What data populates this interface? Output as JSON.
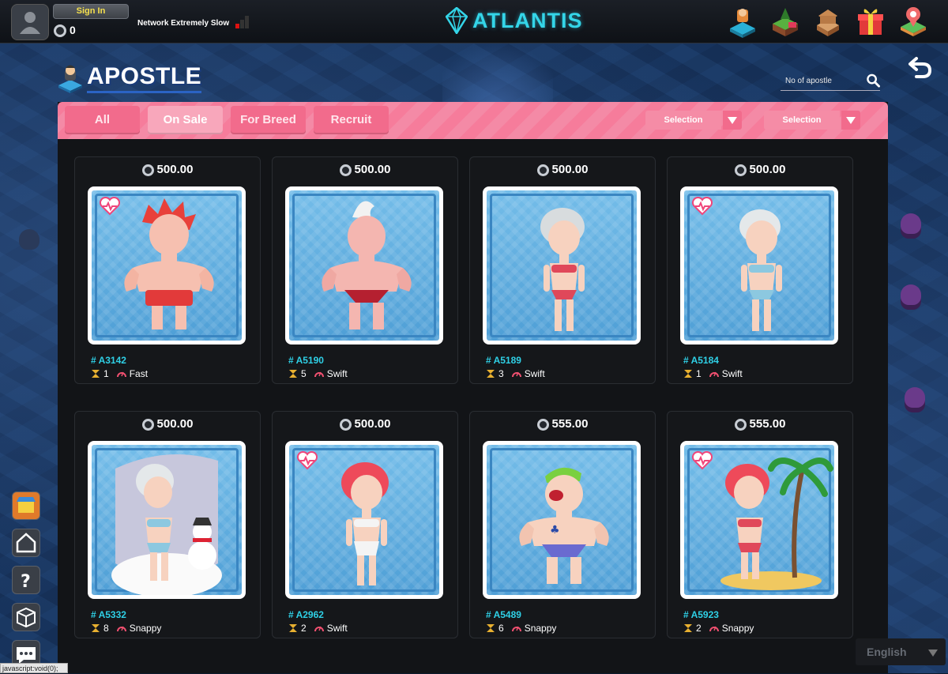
{
  "header": {
    "sign_in_label": "Sign In",
    "balance": "0",
    "network_status": "Network Extremely Slow",
    "logo_text": "ATLANTIS",
    "icons": [
      "apostle-icon",
      "land-icon",
      "museum-icon",
      "gift-icon",
      "map-pin-icon"
    ]
  },
  "page": {
    "title": "APOSTLE",
    "search_placeholder": "No of apostle"
  },
  "filters": {
    "tabs": [
      {
        "label": "All",
        "active": false
      },
      {
        "label": "On Sale",
        "active": true
      },
      {
        "label": "For Breed",
        "active": false
      },
      {
        "label": "Recruit",
        "active": false
      }
    ],
    "selects": [
      {
        "label": "Selection"
      },
      {
        "label": "Selection"
      }
    ]
  },
  "cards": [
    {
      "price": "500.00",
      "id": "# A3142",
      "gen": "1",
      "speed": "Fast",
      "heart": true
    },
    {
      "price": "500.00",
      "id": "# A5190",
      "gen": "5",
      "speed": "Swift",
      "heart": false
    },
    {
      "price": "500.00",
      "id": "# A5189",
      "gen": "3",
      "speed": "Swift",
      "heart": false
    },
    {
      "price": "500.00",
      "id": "# A5184",
      "gen": "1",
      "speed": "Swift",
      "heart": true
    },
    {
      "price": "500.00",
      "id": "# A5332",
      "gen": "8",
      "speed": "Snappy",
      "heart": false
    },
    {
      "price": "500.00",
      "id": "# A2962",
      "gen": "2",
      "speed": "Swift",
      "heart": true
    },
    {
      "price": "555.00",
      "id": "# A5489",
      "gen": "6",
      "speed": "Snappy",
      "heart": false
    },
    {
      "price": "555.00",
      "id": "# A5923",
      "gen": "2",
      "speed": "Snappy",
      "heart": true
    }
  ],
  "sidebar": {
    "items": [
      "shop-icon",
      "home-icon",
      "help-icon",
      "box-icon",
      "chat-icon"
    ]
  },
  "language": "English",
  "statusbar": "javascript:void(0);",
  "colors": {
    "accent_pink": "#f26b8c",
    "id_cyan": "#2fd0e6",
    "logo_cyan": "#34d5e8"
  }
}
